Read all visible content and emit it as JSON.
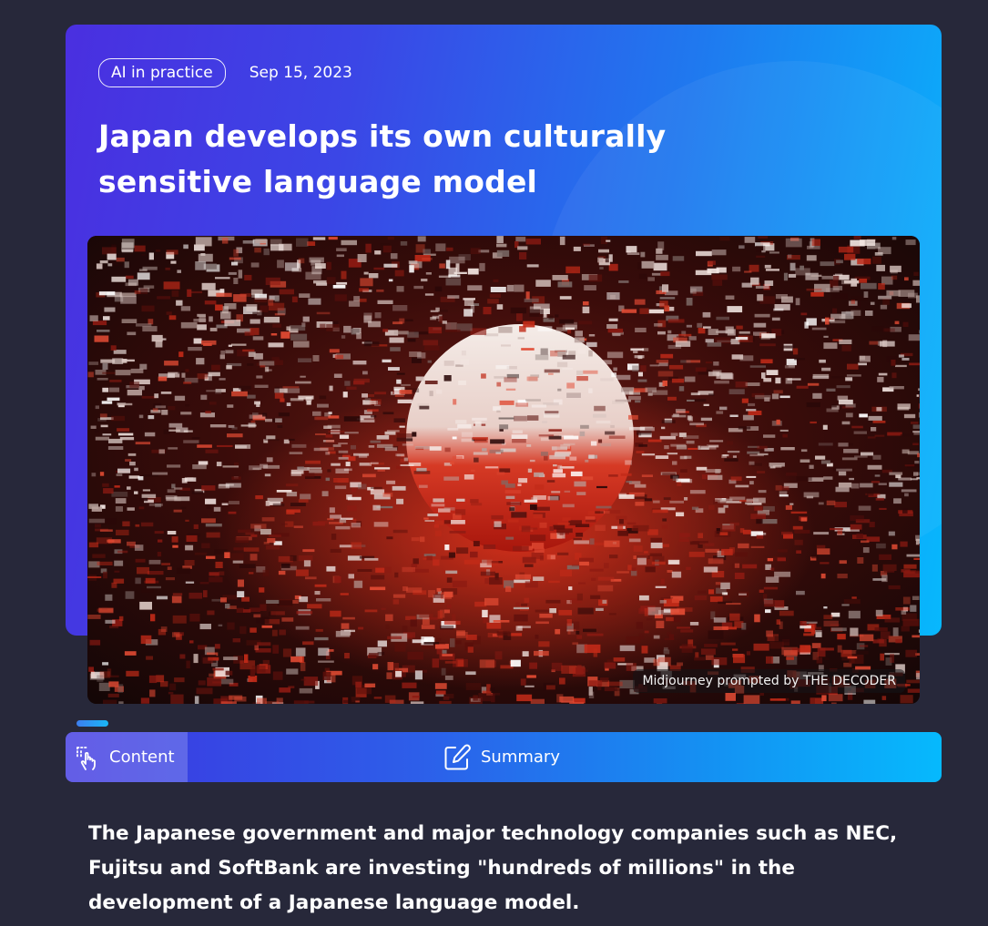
{
  "article": {
    "category": "AI in practice",
    "date": "Sep 15, 2023",
    "title": "Japan develops its own culturally sensitive language model",
    "image_caption": "Midjourney prompted by THE DECODER"
  },
  "tabs": {
    "content_label": "Content",
    "content_icon": "touch-pointer-icon",
    "summary_label": "Summary",
    "summary_icon": "edit-pencil-icon"
  },
  "body": {
    "lead": "The Japanese government and major technology companies such as NEC, Fujitsu and SoftBank are investing \"hundreds of millions\" in the development of a Japanese language model."
  },
  "colors": {
    "page_bg": "#27283a",
    "gradient_start": "#4a2fe0",
    "gradient_end": "#07b8fd",
    "text": "#ffffff"
  }
}
